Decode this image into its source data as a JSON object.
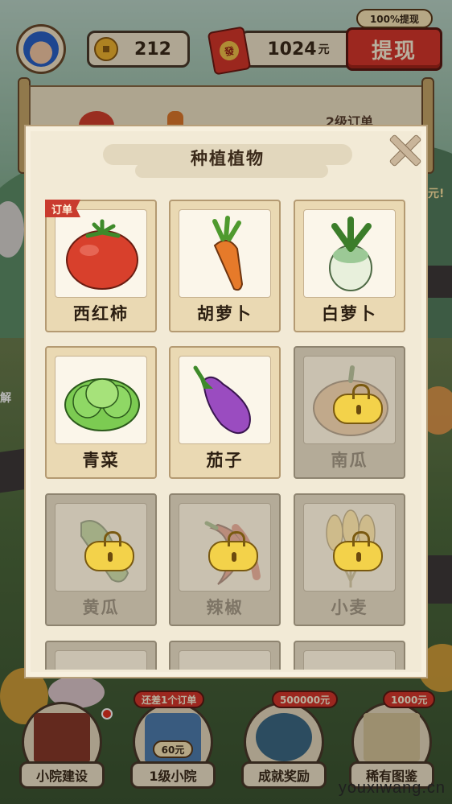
{
  "hud": {
    "coins": "212",
    "money_amount": "1024",
    "money_unit": "元",
    "red_packet_glyph": "發",
    "withdraw_label": "提现",
    "withdraw_tag": "100%提现"
  },
  "background": {
    "order_level_label": "2级订单",
    "side_label_left": "解",
    "side_label_right": "元!"
  },
  "modal": {
    "title": "种植植物",
    "order_tag": "订单",
    "plants": [
      {
        "name": "西红柿",
        "locked": false,
        "icon": "tomato-icon"
      },
      {
        "name": "胡萝卜",
        "locked": false,
        "icon": "carrot-icon"
      },
      {
        "name": "白萝卜",
        "locked": false,
        "icon": "white-radish-icon"
      },
      {
        "name": "青菜",
        "locked": false,
        "icon": "bok-choy-icon"
      },
      {
        "name": "茄子",
        "locked": false,
        "icon": "eggplant-icon"
      },
      {
        "name": "南瓜",
        "locked": true,
        "icon": "pumpkin-icon"
      },
      {
        "name": "黄瓜",
        "locked": true,
        "icon": "cucumber-icon"
      },
      {
        "name": "辣椒",
        "locked": true,
        "icon": "chili-icon"
      },
      {
        "name": "小麦",
        "locked": true,
        "icon": "wheat-icon"
      }
    ]
  },
  "bottom_nav": {
    "items": [
      {
        "label": "小院建设",
        "tag": ""
      },
      {
        "label": "1级小院",
        "tag": "还差1个订单",
        "badge": "60元"
      },
      {
        "label": "成就奖励",
        "tag": "500000元"
      },
      {
        "label": "稀有图鉴",
        "tag": "1000元"
      }
    ]
  },
  "watermark": "youxiwang.cn",
  "colors": {
    "accent_red": "#d9372c",
    "panel_cream": "#f2ead6",
    "card_tan": "#ead9b3",
    "locked_gray": "#b4ab98"
  }
}
